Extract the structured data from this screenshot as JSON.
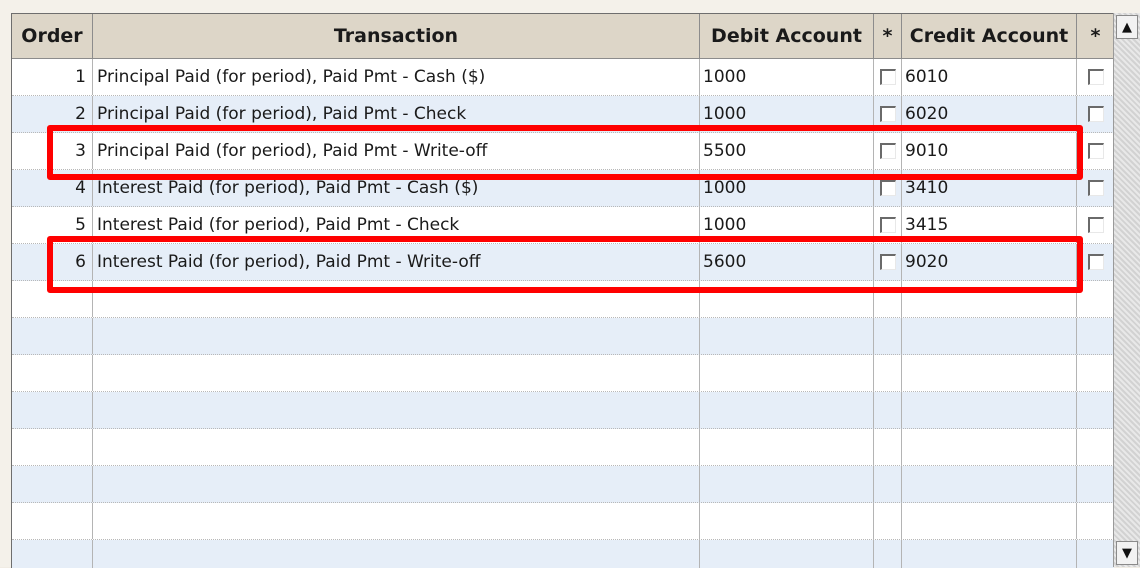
{
  "columns": {
    "order": "Order",
    "transaction": "Transaction",
    "debit_account": "Debit Account",
    "star1": "*",
    "credit_account": "Credit Account",
    "star2": "*"
  },
  "rows": [
    {
      "order": "1",
      "transaction": "Principal Paid (for period), Paid Pmt - Cash ($)",
      "debit": "1000",
      "debit_checked": false,
      "credit": "6010",
      "credit_checked": false,
      "highlighted": false
    },
    {
      "order": "2",
      "transaction": "Principal Paid (for period), Paid Pmt - Check",
      "debit": "1000",
      "debit_checked": false,
      "credit": "6020",
      "credit_checked": false,
      "highlighted": false
    },
    {
      "order": "3",
      "transaction": "Principal Paid (for period), Paid Pmt - Write-off",
      "debit": "5500",
      "debit_checked": false,
      "credit": "9010",
      "credit_checked": false,
      "highlighted": true
    },
    {
      "order": "4",
      "transaction": "Interest Paid (for period), Paid Pmt - Cash ($)",
      "debit": "1000",
      "debit_checked": false,
      "credit": "3410",
      "credit_checked": false,
      "highlighted": false
    },
    {
      "order": "5",
      "transaction": "Interest Paid (for period), Paid Pmt - Check",
      "debit": "1000",
      "debit_checked": false,
      "credit": "3415",
      "credit_checked": false,
      "highlighted": false
    },
    {
      "order": "6",
      "transaction": "Interest Paid (for period), Paid Pmt - Write-off",
      "debit": "5600",
      "debit_checked": false,
      "credit": "9020",
      "credit_checked": false,
      "highlighted": true
    }
  ],
  "empty_row_count": 8,
  "scrollbar": {
    "up_icon": "triangle-up-icon",
    "down_icon": "triangle-down-icon"
  },
  "colors": {
    "highlight": "#ff0000",
    "header_bg": "#ddd6c8",
    "alt_row": "#e6eef8"
  }
}
